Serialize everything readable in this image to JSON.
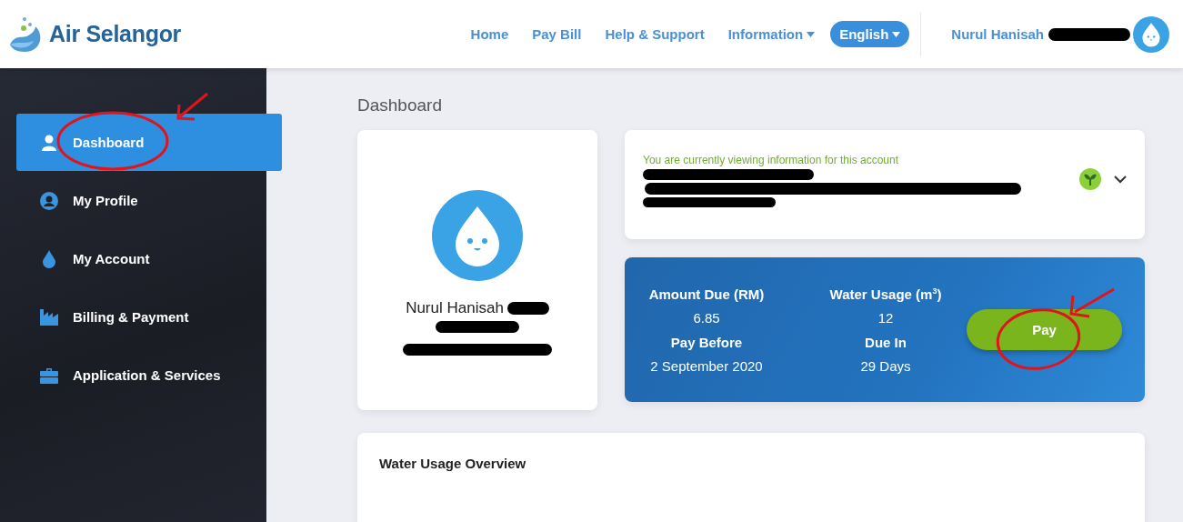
{
  "header": {
    "logo": "Air Selangor",
    "nav": [
      {
        "label": "Home",
        "kind": "link"
      },
      {
        "label": "Pay Bill",
        "kind": "link"
      },
      {
        "label": "Help & Support",
        "kind": "link"
      },
      {
        "label": "Information",
        "kind": "dropdown"
      },
      {
        "label": "English",
        "kind": "pill"
      }
    ],
    "user_name": "Nurul Hanisah"
  },
  "sidebar": {
    "items": [
      {
        "label": "Dashboard",
        "selected": true
      },
      {
        "label": "My Profile",
        "selected": false
      },
      {
        "label": "My Account",
        "selected": false
      },
      {
        "label": "Billing & Payment",
        "selected": false
      },
      {
        "label": "Application & Services",
        "selected": false
      }
    ]
  },
  "page_title": "Dashboard",
  "profile": {
    "name": "Nurul Hanisah"
  },
  "account": {
    "notice": "You are currently viewing information for this account"
  },
  "bill": {
    "fields": [
      {
        "label": "Amount Due (RM)",
        "value": "6.85"
      },
      {
        "label": "Water Usage (m$^{3}$)",
        "value": "12"
      },
      {
        "label": "Pay Before",
        "value": "2 September 2020"
      },
      {
        "label": "Due In",
        "value": "29 Days"
      }
    ],
    "pay_button": "Pay"
  },
  "usage": {
    "title": "Water Usage Overview"
  }
}
